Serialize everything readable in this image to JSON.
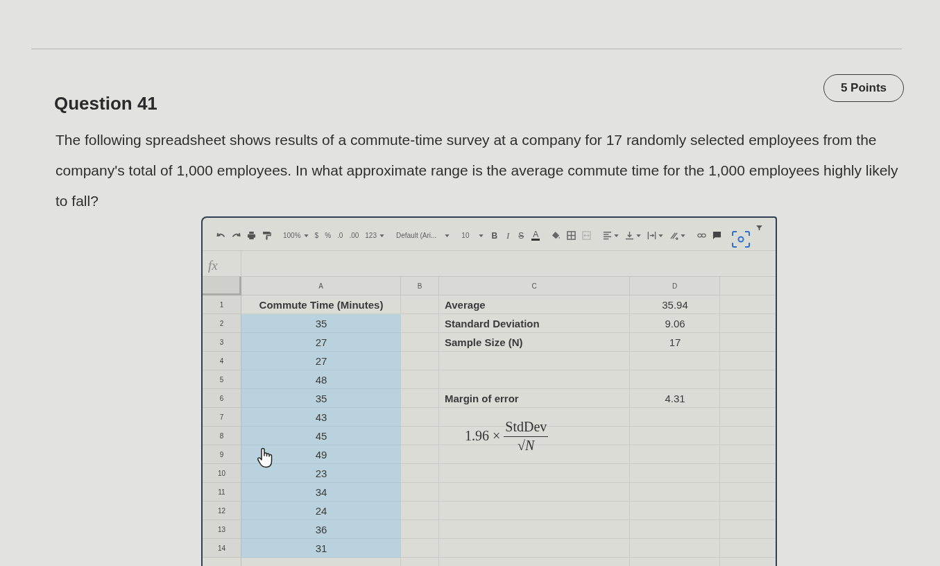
{
  "question": {
    "title": "Question 41",
    "points": "5 Points",
    "text": "The following spreadsheet shows results of a commute-time survey at a company for 17 randomly selected employees from the company's total of 1,000 employees. In what approximate range is the average commute time for the 1,000 employees highly likely to fall?"
  },
  "sheet": {
    "toolbar": {
      "zoom": "100%",
      "number_formats": [
        "$",
        "%",
        ".0",
        ".00"
      ],
      "number_format_menu": "123",
      "font": "Default (Ari...",
      "font_size": "10",
      "text_styles": [
        {
          "label": "B",
          "kind": "bold"
        },
        {
          "label": "I",
          "kind": "italic"
        },
        {
          "label": "S",
          "kind": "strikethrough"
        },
        {
          "label": "A",
          "kind": "text-color"
        }
      ]
    },
    "formula_bar": {
      "label": "fx"
    },
    "columns": [
      "A",
      "B",
      "C",
      "D"
    ],
    "rows": [
      {
        "number": "1",
        "kind": "header",
        "selected": false,
        "a": "Commute Time (Minutes)",
        "c": "Average",
        "d": "35.94"
      },
      {
        "number": "2",
        "kind": "data",
        "selected": true,
        "a": "35",
        "c": "Standard Deviation",
        "d": "9.06"
      },
      {
        "number": "3",
        "kind": "data",
        "selected": true,
        "a": "27",
        "c": "Sample Size (N)",
        "d": "17"
      },
      {
        "number": "4",
        "kind": "data",
        "selected": true,
        "a": "27"
      },
      {
        "number": "5",
        "kind": "data",
        "selected": true,
        "a": "48"
      },
      {
        "number": "6",
        "kind": "data",
        "selected": true,
        "a": "35",
        "c": "Margin of error",
        "d": "4.31"
      },
      {
        "number": "7",
        "kind": "data",
        "selected": true,
        "a": "43",
        "formula": {
          "coefficient": "1.96 ×",
          "numerator": "StdDev",
          "denominator": "√*N*"
        }
      },
      {
        "number": "8",
        "kind": "data",
        "selected": true,
        "a": "45"
      },
      {
        "number": "9",
        "kind": "data",
        "selected": true,
        "a": "49"
      },
      {
        "number": "10",
        "kind": "data",
        "selected": true,
        "a": "23"
      },
      {
        "number": "11",
        "kind": "data",
        "selected": true,
        "a": "34"
      },
      {
        "number": "12",
        "kind": "data",
        "selected": true,
        "a": "24"
      },
      {
        "number": "13",
        "kind": "data",
        "selected": true,
        "a": "36"
      },
      {
        "number": "14",
        "kind": "data",
        "selected": true,
        "a": "31"
      }
    ]
  }
}
